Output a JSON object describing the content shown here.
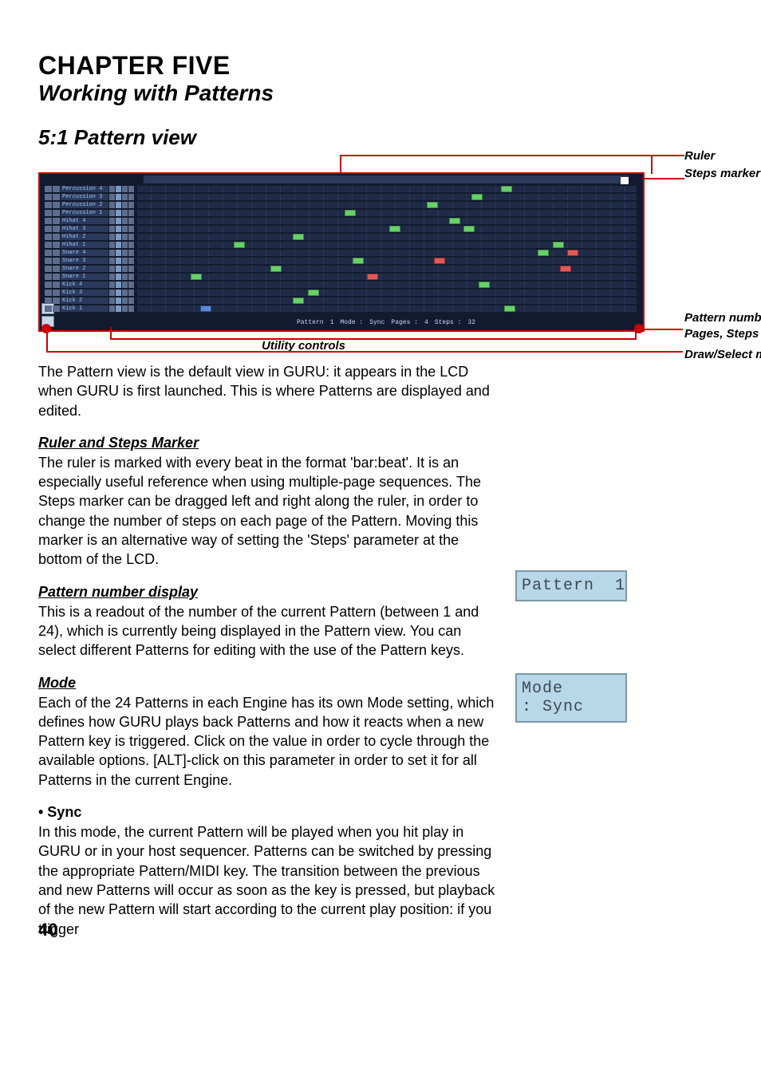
{
  "chapter": {
    "title": "CHAPTER FIVE",
    "subtitle": "Working with Patterns"
  },
  "section": {
    "heading": "5:1 Pattern view"
  },
  "figure": {
    "annotations": {
      "ruler": "Ruler",
      "steps_marker": "Steps marker",
      "pattern_number_etc": "Pattern number display, Mode, Pages, Steps controls",
      "draw_select": "Draw/Select mode buttons",
      "utility": "Utility controls"
    },
    "tracks": [
      "Percussion 4",
      "Percussion 3",
      "Percussion 2",
      "Percussion 1",
      "Hihat 4",
      "Hihat 3",
      "Hihat 2",
      "Hihat 1",
      "Snare 4",
      "Snare 3",
      "Snare 2",
      "Snare 1",
      "Kick 4",
      "Kick 3",
      "Kick 2",
      "Kick 1"
    ],
    "bottom_strip": {
      "pattern_label": "Pattern",
      "pattern_value": "1",
      "mode_label": "Mode :",
      "mode_value": "Sync",
      "pages_label": "Pages :",
      "pages_value": "4",
      "steps_label": "Steps :",
      "steps_value": "32"
    }
  },
  "body": {
    "intro": "The Pattern view is the default view in GURU: it appears in the LCD when GURU is first launched. This is where Patterns are displayed and edited.",
    "ruler_head": "Ruler and Steps Marker",
    "ruler_text": "The ruler is marked with every beat in the format 'bar:beat'. It is an especially useful reference when using multiple-page sequences. The Steps marker can be dragged left and right along the ruler, in order to change the number of steps on each page of the Pattern. Moving this marker is an alternative way of setting the 'Steps' parameter at the bottom of the LCD.",
    "pattern_head": "Pattern number display",
    "pattern_text": "This is a readout of the number of the current Pattern (between 1 and 24), which is currently being displayed in the Pattern view. You can select different Patterns for editing with the use of the Pattern keys.",
    "mode_head": "Mode",
    "mode_text": "Each of the 24 Patterns in each Engine has its own Mode setting, which defines how GURU plays back Patterns and how it reacts when a new Pattern key is triggered. Click on the value in order to cycle through the available options. [ALT]-click on this parameter in order to set it for all Patterns in the current Engine.",
    "sync_head": "• Sync",
    "sync_text": "In this mode, the current Pattern will be played when you hit play in GURU or in your host sequencer. Patterns can be switched by pressing the appropriate Pattern/MIDI key. The transition between the previous and new Patterns will occur as soon as the key is pressed, but playback of the new Pattern will start according to the current play position: if you trigger"
  },
  "lcd_pattern": {
    "label": "Pattern",
    "value": "1"
  },
  "lcd_mode": {
    "label": "Mode :",
    "value": "Sync"
  },
  "page_number": "40"
}
